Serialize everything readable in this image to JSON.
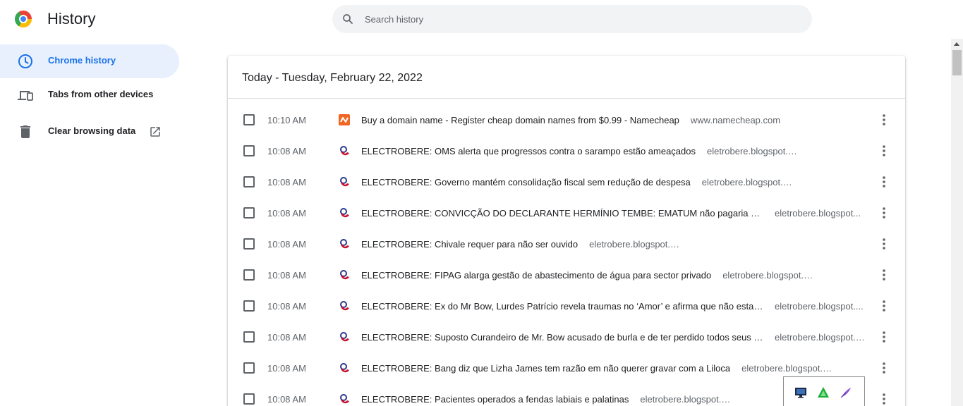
{
  "header": {
    "title": "History",
    "search_placeholder": "Search history",
    "search_value": ""
  },
  "sidebar": {
    "items": [
      {
        "label": "Chrome history",
        "icon": "clock-icon",
        "active": true
      },
      {
        "label": "Tabs from other devices",
        "icon": "devices-icon",
        "active": false
      },
      {
        "label": "Clear browsing data",
        "icon": "trash-icon",
        "active": false,
        "trailing_icon": "open-in-new-icon"
      }
    ]
  },
  "main": {
    "section_title": "Today - Tuesday, February 22, 2022",
    "entries": [
      {
        "time": "10:10 AM",
        "title": "Buy a domain name - Register cheap domain names from $0.99 - Namecheap",
        "domain": "www.namecheap.com",
        "favicon": "namecheap-icon"
      },
      {
        "time": "10:08 AM",
        "title": "ELECTROBERE: OMS alerta que progressos contra o sarampo estão ameaçados",
        "domain": "eletrobere.blogspot.com",
        "favicon": "blogspot-icon"
      },
      {
        "time": "10:08 AM",
        "title": "ELECTROBERE: Governo mantém consolidação fiscal sem redução de despesa",
        "domain": "eletrobere.blogspot.com",
        "favicon": "blogspot-icon"
      },
      {
        "time": "10:08 AM",
        "title": "ELECTROBERE: CONVICÇÃO DO DECLARANTE HERMÍNIO TEMBE: EMATUM não pagaria dívida n...",
        "domain": "eletrobere.blogspot...",
        "favicon": "blogspot-icon"
      },
      {
        "time": "10:08 AM",
        "title": "ELECTROBERE: Chivale requer para não ser ouvido",
        "domain": "eletrobere.blogspot.com",
        "favicon": "blogspot-icon"
      },
      {
        "time": "10:08 AM",
        "title": "ELECTROBERE: FIPAG alarga gestão de abastecimento de água para sector privado",
        "domain": "eletrobere.blogspot.com",
        "favicon": "blogspot-icon"
      },
      {
        "time": "10:08 AM",
        "title": "ELECTROBERE: Ex do Mr Bow, Lurdes Patrício revela traumas no ‘Amor’ e afirma que não esta co...",
        "domain": "eletrobere.blogspot....",
        "favicon": "blogspot-icon"
      },
      {
        "time": "10:08 AM",
        "title": "ELECTROBERE: Suposto Curandeiro de Mr. Bow acusado de burla e de ter perdido todos seus \"p...",
        "domain": "eletrobere.blogspot.c...",
        "favicon": "blogspot-icon"
      },
      {
        "time": "10:08 AM",
        "title": "ELECTROBERE: Bang diz que Lizha James tem razão em não querer gravar com a Liloca",
        "domain": "eletrobere.blogspot.com",
        "favicon": "blogspot-icon"
      },
      {
        "time": "10:08 AM",
        "title": "ELECTROBERE: Pacientes operados a fendas labiais e palatinas",
        "domain": "eletrobere.blogspot.com",
        "favicon": "blogspot-icon"
      }
    ]
  },
  "colors": {
    "accent": "#1a73e8",
    "active_bg": "#e8f0fe",
    "search_bg": "#f1f3f4",
    "secondary_text": "#5f6368"
  },
  "tray": {
    "icons": [
      "monitor-icon",
      "green-triangle-icon",
      "feather-icon"
    ]
  }
}
